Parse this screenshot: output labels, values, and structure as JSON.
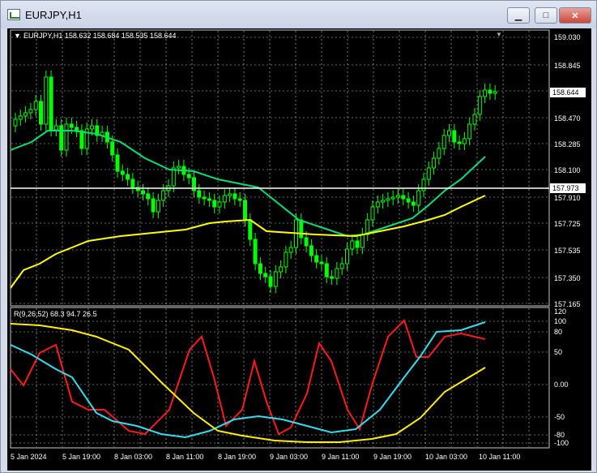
{
  "window": {
    "title": "EURJPY,H1",
    "minimize_glyph": "▁",
    "maximize_glyph": "□",
    "close_glyph": "✕"
  },
  "chart": {
    "symbol_header": "EURJPY,H1  158.632 158.684 158.535 158.644",
    "price_axis_labels": [
      "159.030",
      "158.845",
      "158.470",
      "158.285",
      "158.100",
      "157.910",
      "157.725",
      "157.535",
      "157.350",
      "157.165"
    ],
    "current_price": "158.644",
    "hline_price": "157.973",
    "indicator_header": "R(9,26,52) 68.3 94.7 26.5",
    "indicator_axis_labels": [
      "120",
      "100",
      "80",
      "50",
      "0.00",
      "-50",
      "-80",
      "-100"
    ],
    "time_labels": [
      "5 Jan 2024",
      "5 Jan 19:00",
      "8 Jan 03:00",
      "8 Jan 11:00",
      "8 Jan 19:00",
      "9 Jan 03:00",
      "9 Jan 11:00",
      "9 Jan 19:00",
      "10 Jan 03:00",
      "10 Jan 11:00"
    ],
    "colors": {
      "background": "#000000",
      "grid": "#c8c8c8",
      "candles": "#00ff00",
      "ma_fast": "#00e07a",
      "ma_slow": "#ffff00",
      "osc_red": "#ff1a1a",
      "osc_cyan": "#33ddee",
      "osc_yellow": "#ffee00"
    }
  }
}
